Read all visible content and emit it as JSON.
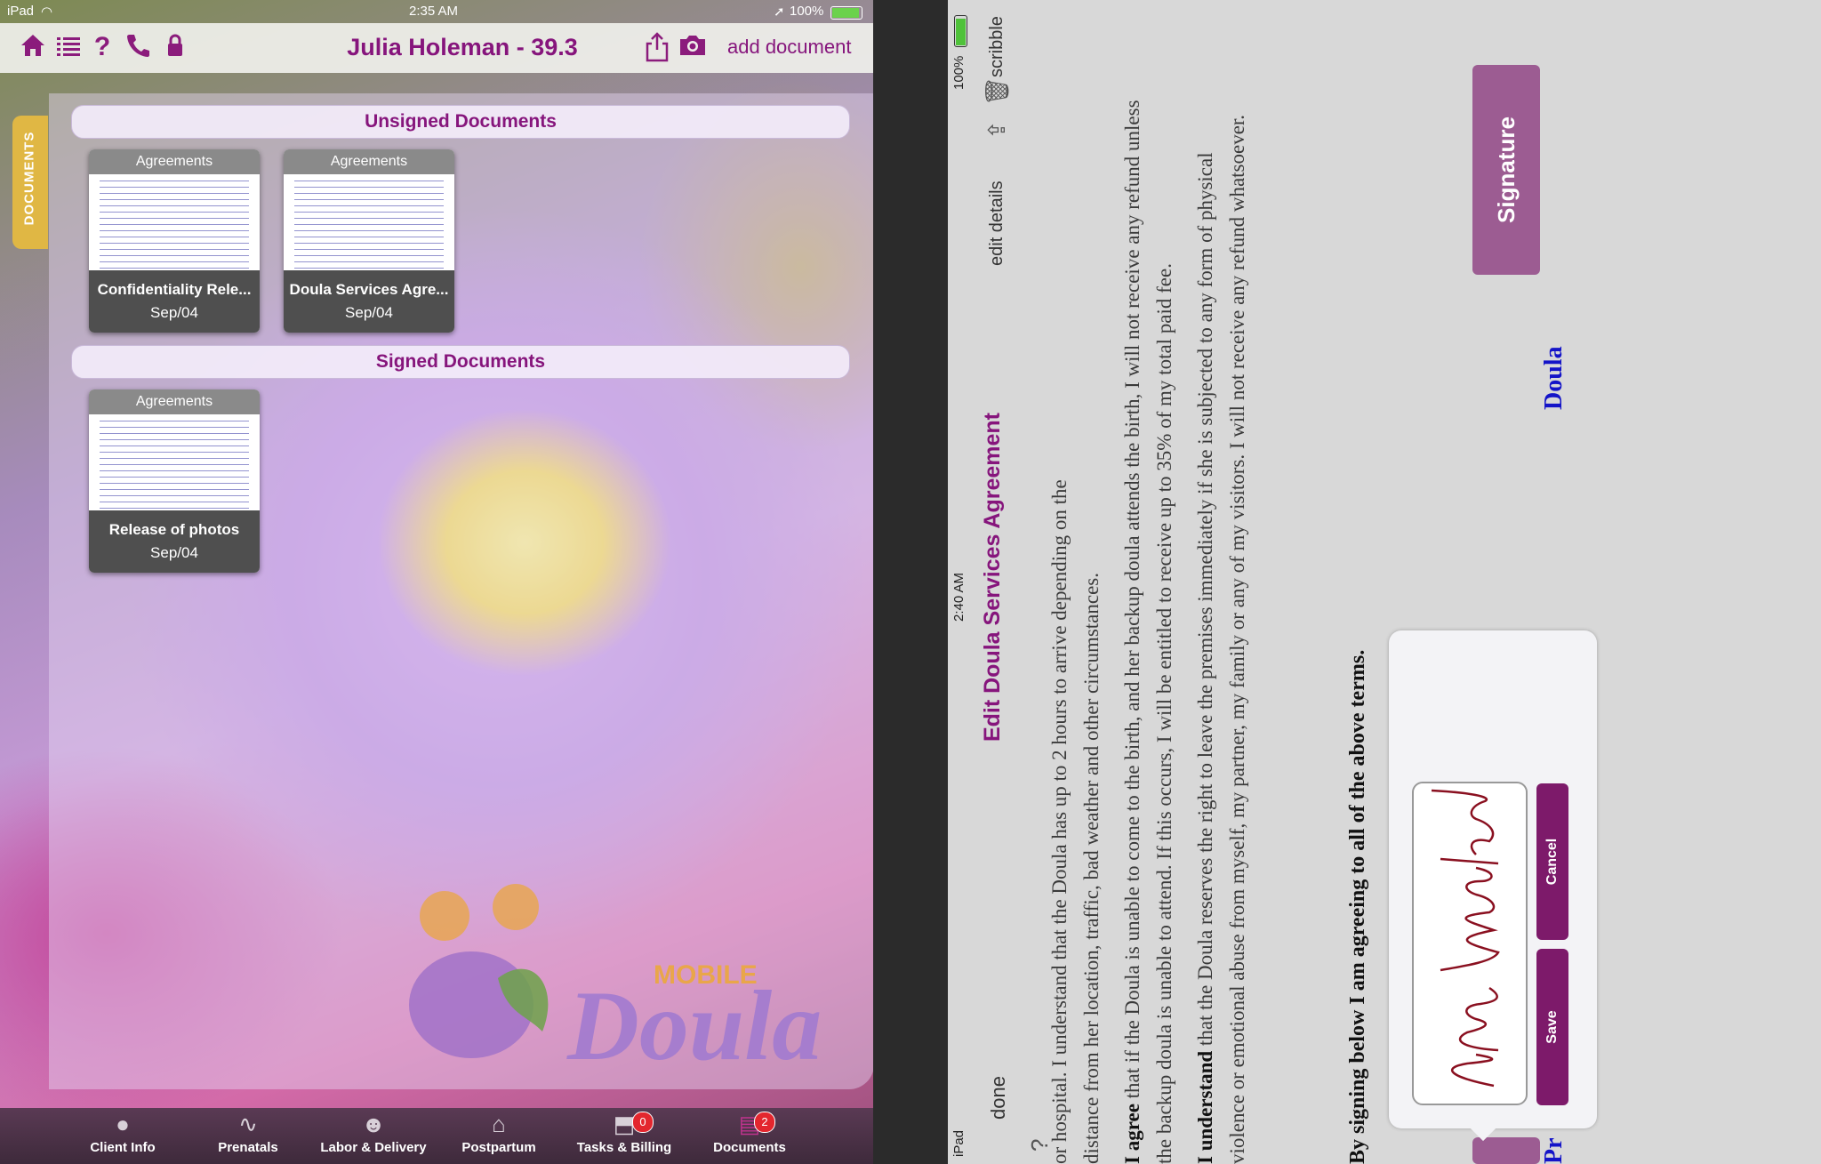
{
  "left": {
    "status": {
      "device": "iPad",
      "time": "2:35 AM",
      "battery": "100%"
    },
    "header": {
      "title": "Julia Holeman - 39.3",
      "add_label": "add document"
    },
    "side_tab": "DOCUMENTS",
    "sections": {
      "unsigned": "Unsigned Documents",
      "signed": "Signed Documents"
    },
    "unsigned_docs": [
      {
        "category": "Agreements",
        "name": "Confidentiality Rele...",
        "date": "Sep/04"
      },
      {
        "category": "Agreements",
        "name": "Doula Services Agre...",
        "date": "Sep/04"
      }
    ],
    "signed_docs": [
      {
        "category": "Agreements",
        "name": "Release of photos",
        "date": "Sep/04"
      }
    ],
    "logo": {
      "top": "MOBILE",
      "main": "Doula"
    },
    "tabs": [
      {
        "label": "Client Info"
      },
      {
        "label": "Prenatals"
      },
      {
        "label": "Labor & Delivery"
      },
      {
        "label": "Postpartum"
      },
      {
        "label": "Tasks & Billing",
        "badge": "0"
      },
      {
        "label": "Documents",
        "badge": "2"
      }
    ]
  },
  "right": {
    "status": {
      "device": "iPad",
      "time": "2:40 AM",
      "battery": "100%"
    },
    "nav": {
      "done": "done",
      "title": "Edit Doula Services Agreement",
      "details": "edit details",
      "scribble": "scribble"
    },
    "text": {
      "line0": "or hospital. I understand that the Doula has up to 2 hours to arrive depending on the",
      "line1": "distance from her location, traffic, bad weather and other circumstances.",
      "agree_bold": "I agree",
      "agree_rest": " that if the Doula is unable to come to the birth, and her backup doula attends the birth, I will not receive any refund unless the backup doula is unable to attend. If this occurs, I will be entitled to receive up to 35% of my total paid fee.",
      "understand_bold": "I understand",
      "understand_rest": " that the Doula reserves the right to leave the premises immediately if she is subjected to any form of physical violence or emotional abuse from myself, my partner, my family or any of my visitors. I will not receive any refund whatsoever."
    },
    "declaration": "By signing below I am agreeing to all of the above terms.",
    "signature_button": "Signature",
    "doula_label": "Doula",
    "pr_label": "Pr",
    "popover": {
      "save": "Save",
      "cancel": "Cancel"
    }
  }
}
